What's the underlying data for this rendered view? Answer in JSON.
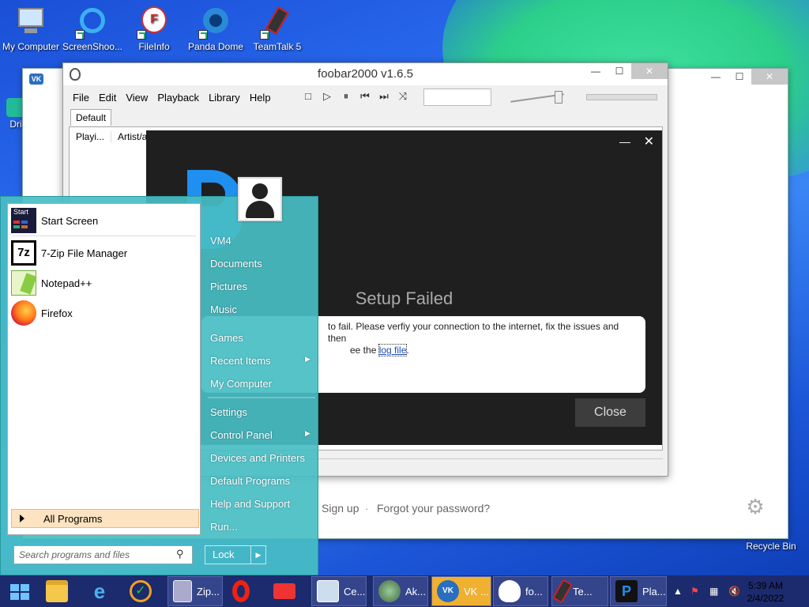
{
  "desktop": {
    "icons": [
      {
        "label": "My Computer"
      },
      {
        "label": "ScreenShoo..."
      },
      {
        "label": "FileInfo"
      },
      {
        "label": "Panda Dome"
      },
      {
        "label": "TeamTalk 5"
      },
      {
        "label": "Dri"
      },
      {
        "label": "Recycle Bin"
      }
    ]
  },
  "vk_window": {
    "signup": "Sign up",
    "separator": "·",
    "forgot": "Forgot your password?"
  },
  "foobar": {
    "title": "foobar2000 v1.6.5",
    "menu": [
      "File",
      "Edit",
      "View",
      "Playback",
      "Library",
      "Help"
    ],
    "tab": "Default",
    "columns": [
      "Playi...",
      "Artist/al"
    ]
  },
  "setup": {
    "title": "Setup Failed",
    "message_start": "to fail.  Please verfiy your connection to the internet, fix the issues and then",
    "message_line2": "ee the ",
    "link": "log file",
    "message_end": ".",
    "close": "Close"
  },
  "start_menu": {
    "pinned": [
      "Start Screen",
      "7-Zip File Manager",
      "Notepad++",
      "Firefox"
    ],
    "all_programs": "All Programs",
    "search_placeholder": "Search programs and files",
    "right": [
      "VM4",
      "Documents",
      "Pictures",
      "Music",
      "Games",
      "Recent Items",
      "My Computer",
      "Settings",
      "Control Panel",
      "Devices and Printers",
      "Default Programs",
      "Help and Support",
      "Run..."
    ],
    "lock": "Lock"
  },
  "taskbar": {
    "items": [
      "Zip...",
      "Ce...",
      "Ak...",
      "VK ...",
      "fo...",
      "Te...",
      "Pla..."
    ],
    "time": "5:39 AM",
    "date": "2/4/2022"
  },
  "colors": {
    "taskbar": "#1c2a6e",
    "start_menu": "#48bec4",
    "setup_bg": "#1f1f1f",
    "link": "#1a4db8"
  }
}
